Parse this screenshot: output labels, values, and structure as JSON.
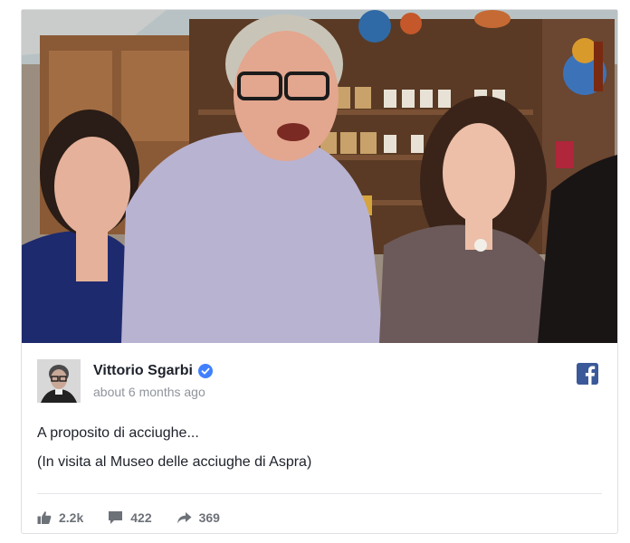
{
  "post": {
    "author": "Vittorio Sgarbi",
    "timestamp": "about 6 months ago",
    "verified": true,
    "lines": [
      "A proposito di acciughe...",
      "(In visita al Museo delle acciughe di Aspra)"
    ]
  },
  "stats": {
    "likes": "2.2k",
    "comments": "422",
    "shares": "369"
  },
  "icons": {
    "like": "thumbs-up-icon",
    "comment": "comment-icon",
    "share": "share-arrow-icon",
    "brand": "facebook-icon",
    "verified": "verified-badge-icon"
  },
  "colors": {
    "brand": "#3b5998",
    "verified": "#4080ff",
    "muted": "#90949c",
    "stat": "#6d7178"
  }
}
